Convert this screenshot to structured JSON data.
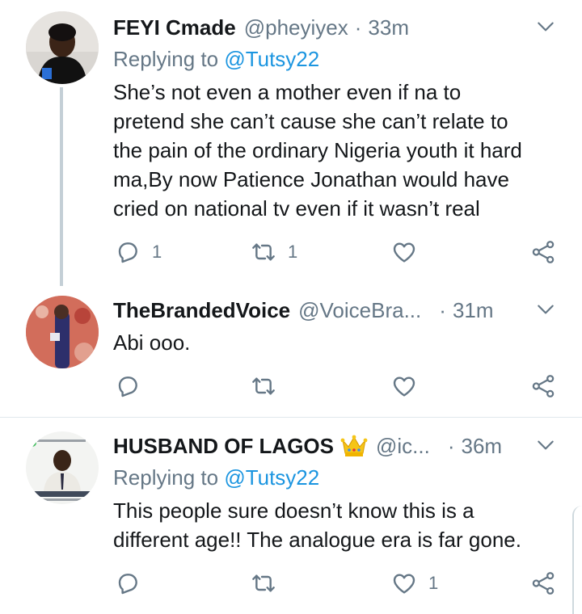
{
  "tweets": [
    {
      "name": "FEYI Cmade",
      "handle": "@pheyiyex",
      "sep": "·",
      "time": "33m",
      "replying_prefix": "Replying to ",
      "replying_to": "@Tutsy22",
      "body": "She’s not even a mother even if na to\npretend she can’t cause she can’t relate to\nthe pain of the ordinary Nigeria youth it hard\nma,By now Patience Jonathan would have\ncried on national tv even if it wasn’t real",
      "reply_count": "1",
      "retweet_count": "1",
      "like_count": ""
    },
    {
      "name": "TheBrandedVoice",
      "handle": "@VoiceBra...",
      "sep": "·",
      "time": "31m",
      "body": "Abi ooo.",
      "reply_count": "",
      "retweet_count": "",
      "like_count": ""
    },
    {
      "name": "HUSBAND OF LAGOS",
      "handle": "@ic...",
      "sep": "·",
      "time": "36m",
      "replying_prefix": "Replying to ",
      "replying_to": "@Tutsy22",
      "body": "This people sure doesn’t know this is a\ndifferent age!!  The analogue era is far gone.",
      "reply_count": "",
      "retweet_count": "",
      "like_count": "1"
    }
  ],
  "colors": {
    "accent": "#1b95e0",
    "secondary_text": "#657786",
    "primary_text": "#14171a",
    "divider": "#e1e8ed"
  }
}
